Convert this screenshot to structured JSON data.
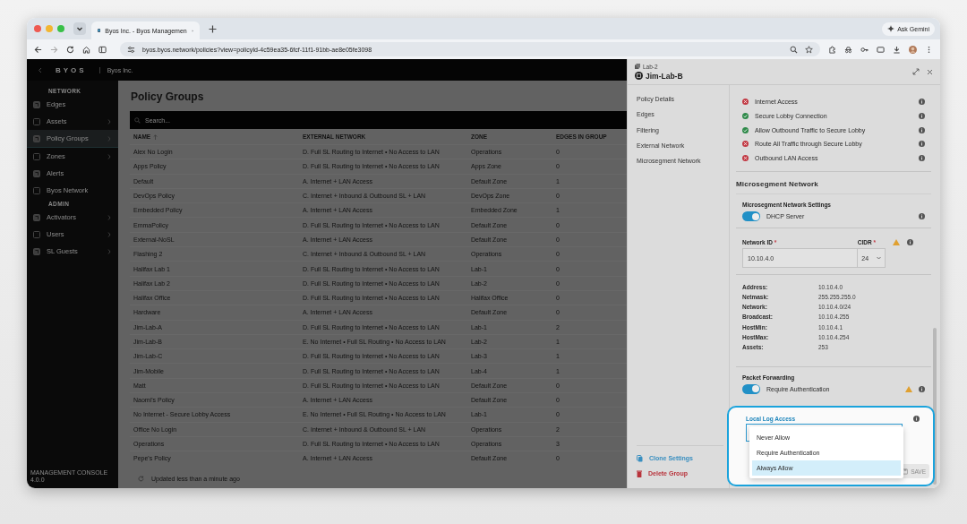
{
  "browser": {
    "tab_title": "Byos Inc. - Byos Managemen",
    "url": "byos.byos.network/policies?view=policyId-4c59ea35-6fcf-11f1-91bb-ae8e05fe3098",
    "ask_button": "Ask Gemini"
  },
  "sidebar": {
    "brand": "BYOS",
    "org": "Byos Inc.",
    "sections": [
      {
        "title": "NETWORK",
        "items": [
          {
            "label": "Edges",
            "expandable": false,
            "selected": false
          },
          {
            "label": "Assets",
            "expandable": true,
            "selected": false
          },
          {
            "label": "Policy Groups",
            "expandable": true,
            "selected": true
          },
          {
            "label": "Zones",
            "expandable": true,
            "selected": false
          },
          {
            "label": "Alerts",
            "expandable": false,
            "selected": false
          },
          {
            "label": "Byos Network",
            "expandable": false,
            "selected": false
          }
        ]
      },
      {
        "title": "ADMIN",
        "items": [
          {
            "label": "Activators",
            "expandable": true,
            "selected": false
          },
          {
            "label": "Users",
            "expandable": true,
            "selected": false
          },
          {
            "label": "SL Guests",
            "expandable": true,
            "selected": false
          }
        ]
      }
    ],
    "footer": "MANAGEMENT CONSOLE 4.0.0"
  },
  "main": {
    "title": "Policy Groups",
    "search": {
      "placeholder": "Search..."
    },
    "columns": [
      {
        "label": "NAME",
        "sorted": true
      },
      {
        "label": "EXTERNAL NETWORK",
        "sorted": false
      },
      {
        "label": "ZONE",
        "sorted": false
      },
      {
        "label": "EDGES IN GROUP",
        "sorted": false
      }
    ],
    "rows": [
      [
        "Alex No Login",
        "D. Full SL Routing to Internet • No Access to LAN",
        "Operations",
        "0"
      ],
      [
        "Apps Policy",
        "D. Full SL Routing to Internet • No Access to LAN",
        "Apps Zone",
        "0"
      ],
      [
        "Default",
        "A. Internet + LAN Access",
        "Default Zone",
        "1"
      ],
      [
        "DevOps Policy",
        "C. Internet + Inbound & Outbound SL + LAN",
        "DevOps Zone",
        "0"
      ],
      [
        "Embedded Policy",
        "A. Internet + LAN Access",
        "Embedded Zone",
        "1"
      ],
      [
        "EmmaPolicy",
        "D. Full SL Routing to Internet • No Access to LAN",
        "Default Zone",
        "0"
      ],
      [
        "External-NoSL",
        "A. Internet + LAN Access",
        "Default Zone",
        "0"
      ],
      [
        "Flashing 2",
        "C. Internet + Inbound & Outbound SL + LAN",
        "Operations",
        "0"
      ],
      [
        "Halifax Lab 1",
        "D. Full SL Routing to Internet • No Access to LAN",
        "Lab-1",
        "0"
      ],
      [
        "Halifax Lab 2",
        "D. Full SL Routing to Internet • No Access to LAN",
        "Lab-2",
        "0"
      ],
      [
        "Halifax Office",
        "D. Full SL Routing to Internet • No Access to LAN",
        "Halifax Office",
        "0"
      ],
      [
        "Hardware",
        "A. Internet + LAN Access",
        "Default Zone",
        "0"
      ],
      [
        "Jim-Lab-A",
        "D. Full SL Routing to Internet • No Access to LAN",
        "Lab-1",
        "2"
      ],
      [
        "Jim-Lab-B",
        "E. No Internet • Full SL Routing • No Access to LAN",
        "Lab-2",
        "1"
      ],
      [
        "Jim-Lab-C",
        "D. Full SL Routing to Internet • No Access to LAN",
        "Lab-3",
        "1"
      ],
      [
        "Jim-Mobile",
        "D. Full SL Routing to Internet • No Access to LAN",
        "Lab-4",
        "1"
      ],
      [
        "Matt",
        "D. Full SL Routing to Internet • No Access to LAN",
        "Default Zone",
        "0"
      ],
      [
        "Naomi's Policy",
        "A. Internet + LAN Access",
        "Default Zone",
        "0"
      ],
      [
        "No Internet - Secure Lobby Access",
        "E. No Internet • Full SL Routing • No Access to LAN",
        "Lab-1",
        "0"
      ],
      [
        "Office No Login",
        "C. Internet + Inbound & Outbound SL + LAN",
        "Operations",
        "2"
      ],
      [
        "Operations",
        "D. Full SL Routing to Internet • No Access to LAN",
        "Operations",
        "3"
      ],
      [
        "Pepe's Policy",
        "A. Internet + LAN Access",
        "Default Zone",
        "0"
      ]
    ],
    "footer": "Updated less than a minute ago"
  },
  "panel": {
    "breadcrumb": "Lab-2",
    "title": "Jim-Lab-B",
    "nav": [
      "Policy Details",
      "Edges",
      "Filtering",
      "External Network",
      "Microsegment Network"
    ],
    "actions": [
      {
        "label": "Clone Settings",
        "kind": "clone"
      },
      {
        "label": "Delete Group",
        "kind": "delete"
      }
    ],
    "rules": [
      {
        "label": "Internet Access",
        "allowed": false
      },
      {
        "label": "Secure Lobby Connection",
        "allowed": true
      },
      {
        "label": "Allow Outbound Traffic to Secure Lobby",
        "allowed": true
      },
      {
        "label": "Route All Traffic through Secure Lobby",
        "allowed": false
      },
      {
        "label": "Outbound LAN Access",
        "allowed": false
      }
    ],
    "section_title": "Microsegment Network",
    "settings": {
      "title": "Microsegment Network Settings",
      "toggle": {
        "label": "DHCP Server",
        "on": true
      }
    },
    "network_id": {
      "label": "Network ID",
      "required_mark": "*",
      "value": "10.10.4.0"
    },
    "cidr": {
      "label": "CIDR",
      "required_mark": "*",
      "value": "24"
    },
    "network_warning": true,
    "details": [
      {
        "label": "Address:",
        "value": "10.10.4.0"
      },
      {
        "label": "Netmask:",
        "value": "255.255.255.0"
      },
      {
        "label": "Network:",
        "value": "10.10.4.0/24"
      },
      {
        "label": "Broadcast:",
        "value": "10.10.4.255"
      },
      {
        "label": "HostMin:",
        "value": "10.10.4.1"
      },
      {
        "label": "HostMax:",
        "value": "10.10.4.254"
      },
      {
        "label": "Assets:",
        "value": "253"
      }
    ],
    "packet_forwarding": {
      "title": "Packet Forwarding",
      "toggle": {
        "label": "Require Authentication",
        "on": true
      },
      "warning": true
    },
    "local_log": {
      "label": "Local Log Access",
      "expanded": true,
      "options": [
        {
          "label": "Never Allow",
          "selected": false
        },
        {
          "label": "Require Authentication",
          "selected": false
        },
        {
          "label": "Always Allow",
          "selected": true
        }
      ]
    },
    "save": {
      "label": "SAVE",
      "disabled": true
    }
  }
}
